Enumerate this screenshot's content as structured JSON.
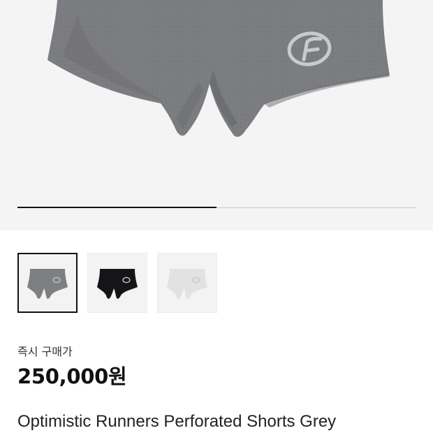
{
  "product": {
    "images": [
      {
        "name": "Grey",
        "color": "#7e7f82",
        "logo": "#c9cacc"
      },
      {
        "name": "Black",
        "color": "#151518",
        "logo": "#d8d8d8"
      },
      {
        "name": "White",
        "color": "#e2e2e2",
        "logo": "#c4c4c4"
      }
    ],
    "selected_index": 0,
    "gallery_progress": 0.5,
    "price_label": "즉시 구매가",
    "price": "250,000원",
    "title": "Optimistic Runners Perforated Shorts Grey"
  },
  "colors": {
    "hero_bg": "#f4f4f4",
    "shorts_main": "#7c7d80",
    "shorts_shadow": "#65666a",
    "logo": "#c9cacc",
    "progress_active": "#111111",
    "progress_track": "#c8c8c8"
  }
}
